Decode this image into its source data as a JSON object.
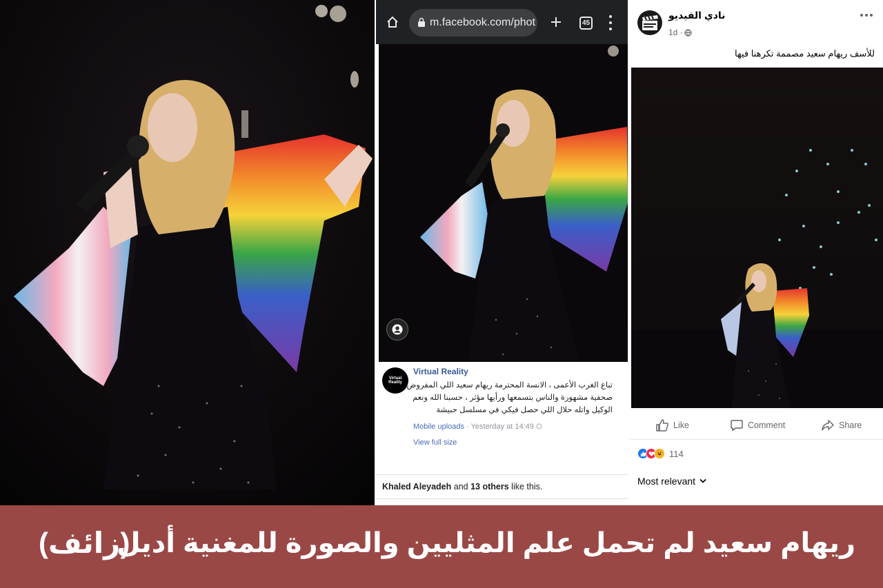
{
  "browser": {
    "url": "m.facebook.com/phot",
    "tab_count": "45",
    "icons": [
      "home-icon",
      "lock-icon",
      "plus-icon",
      "tabs-icon",
      "more-vert-icon"
    ]
  },
  "mobile_post": {
    "avatar_text": "Virtual Reality",
    "author": "Virtual Reality",
    "text": "تباع الغرب الأعمى ، الانسة المحترمة ريهام سعيد اللي المفروض صحفية مشهورة والناس بتسمعها ورأيها مؤثر ، حسبنا الله ونعم الوكيل واتله حلال اللي حصل فيكي في مسلسل حبيشة",
    "source": "Mobile uploads",
    "separator": "·",
    "time": "Yesterday at 14:49",
    "view_full_size": "View full size",
    "likes_name": "Khaled Aleyadeh",
    "likes_and": "and",
    "likes_others": "13 others",
    "likes_suffix": "like this."
  },
  "desktop_post": {
    "page_name": "نادي الفيديو",
    "time": "1d",
    "caption": "للأسف ريهام سعيد مصممة تكرهنا فيها",
    "actions": {
      "like": "Like",
      "comment": "Comment",
      "share": "Share"
    },
    "reaction_count": "114",
    "sort_label": "Most relevant",
    "colors": {
      "like": "#1877f2",
      "love": "#f02849",
      "haha": "#f7b125"
    }
  },
  "banner": {
    "title": "ريهام سعيد لم تحمل علم المثليين والصورة للمغنية أديل",
    "verdict": "(زائف)",
    "color": "#9a4846"
  }
}
